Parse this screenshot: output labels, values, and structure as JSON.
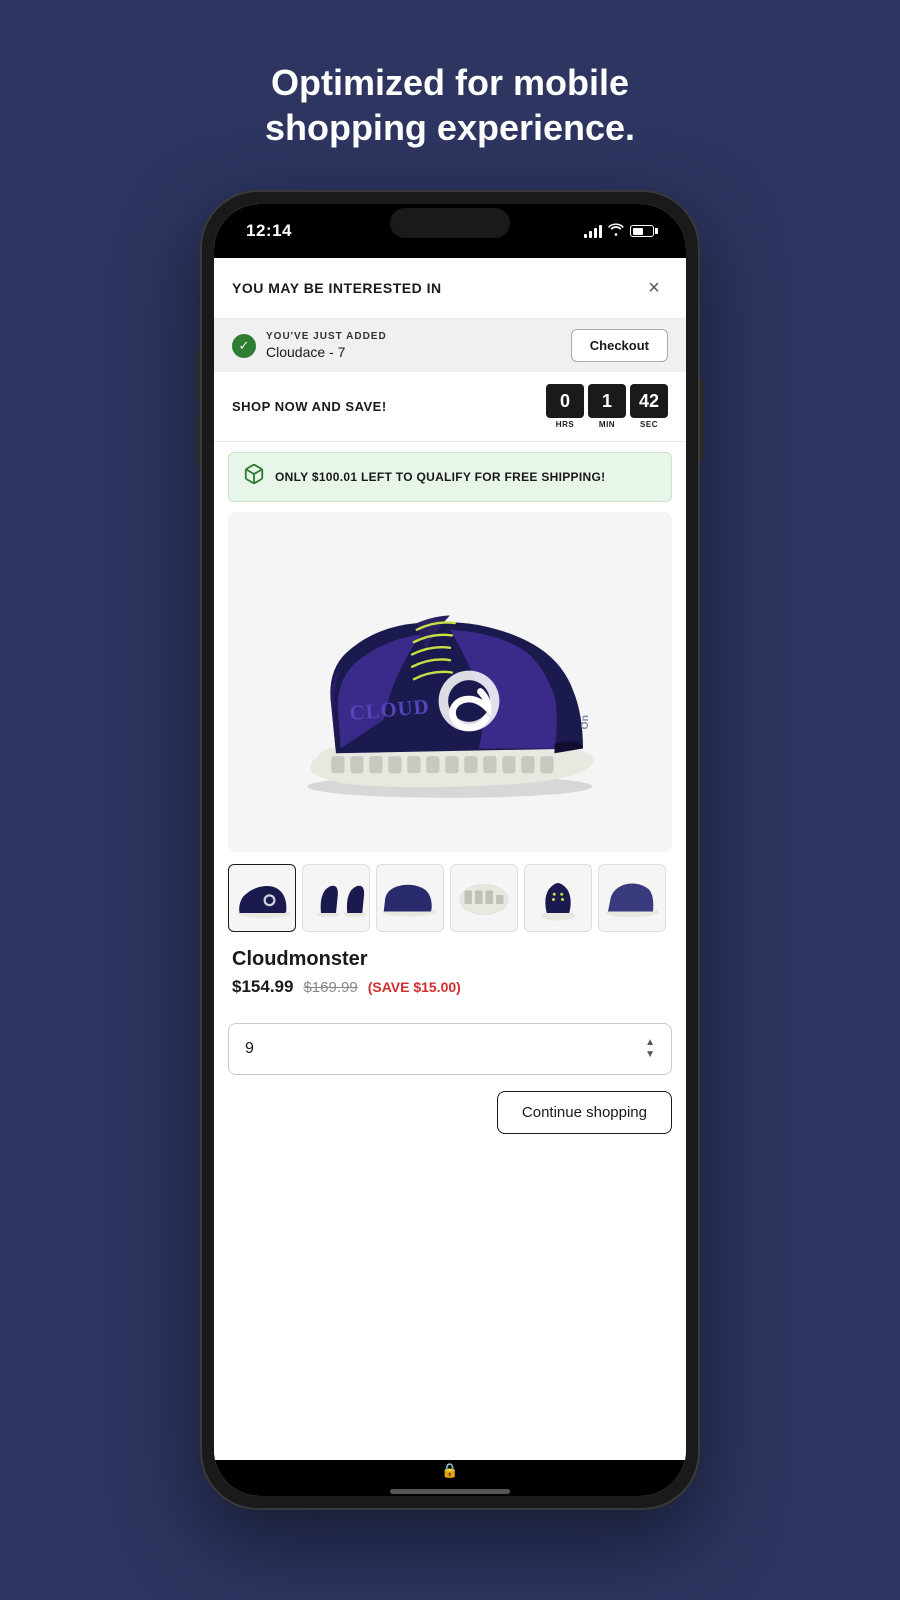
{
  "headline": {
    "line1": "Optimized for mobile",
    "line2": "shopping experience."
  },
  "phone": {
    "status_bar": {
      "time": "12:14",
      "signal_bars": 4,
      "battery_percent": 55
    },
    "modal": {
      "title": "YOU MAY BE INTERESTED IN",
      "close_label": "×",
      "added_section": {
        "badge": "YOU'VE JUST ADDED",
        "product": "Cloudace - 7",
        "checkout_btn": "Checkout"
      },
      "timer_section": {
        "label": "SHOP NOW AND SAVE!",
        "hrs": "0",
        "min": "1",
        "sec": "42",
        "hrs_label": "HRS",
        "min_label": "MIN",
        "sec_label": "SEC"
      },
      "shipping_banner": {
        "text": "ONLY $100.01 LEFT TO QUALIFY FOR FREE SHIPPING!"
      },
      "product": {
        "name": "Cloudmonster",
        "price_current": "$154.99",
        "price_original": "$169.99",
        "price_save": "(SAVE $15.00)"
      },
      "size_selector": {
        "value": "9"
      },
      "continue_btn": "Continue shopping"
    }
  }
}
